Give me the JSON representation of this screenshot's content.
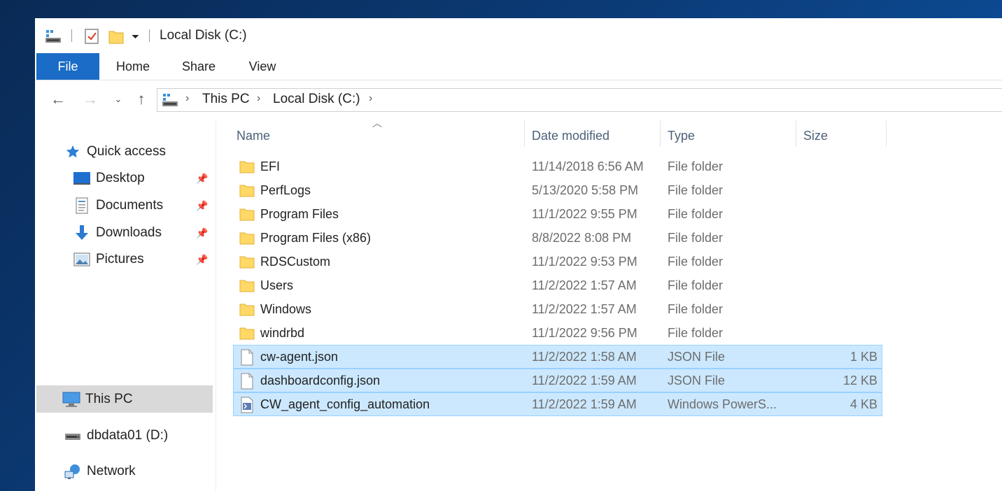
{
  "window": {
    "title": "Local Disk (C:)"
  },
  "ribbon": {
    "tabs": [
      "File",
      "Home",
      "Share",
      "View"
    ]
  },
  "address": {
    "crumbs": [
      "This PC",
      "Local Disk (C:)"
    ]
  },
  "nav": {
    "quick_access": "Quick access",
    "desktop": "Desktop",
    "documents": "Documents",
    "downloads": "Downloads",
    "pictures": "Pictures",
    "this_pc": "This PC",
    "dbdata": "dbdata01 (D:)",
    "network": "Network"
  },
  "columns": {
    "name": "Name",
    "date": "Date modified",
    "type": "Type",
    "size": "Size"
  },
  "files": [
    {
      "name": "EFI",
      "date": "11/14/2018 6:56 AM",
      "type": "File folder",
      "size": "",
      "icon": "folder-icon",
      "selected": false
    },
    {
      "name": "PerfLogs",
      "date": "5/13/2020 5:58 PM",
      "type": "File folder",
      "size": "",
      "icon": "folder-icon",
      "selected": false
    },
    {
      "name": "Program Files",
      "date": "11/1/2022 9:55 PM",
      "type": "File folder",
      "size": "",
      "icon": "folder-icon",
      "selected": false
    },
    {
      "name": "Program Files (x86)",
      "date": "8/8/2022 8:08 PM",
      "type": "File folder",
      "size": "",
      "icon": "folder-icon",
      "selected": false
    },
    {
      "name": "RDSCustom",
      "date": "11/1/2022 9:53 PM",
      "type": "File folder",
      "size": "",
      "icon": "folder-icon",
      "selected": false
    },
    {
      "name": "Users",
      "date": "11/2/2022 1:57 AM",
      "type": "File folder",
      "size": "",
      "icon": "folder-icon",
      "selected": false
    },
    {
      "name": "Windows",
      "date": "11/2/2022 1:57 AM",
      "type": "File folder",
      "size": "",
      "icon": "folder-icon",
      "selected": false
    },
    {
      "name": "windrbd",
      "date": "11/1/2022 9:56 PM",
      "type": "File folder",
      "size": "",
      "icon": "folder-icon",
      "selected": false
    },
    {
      "name": "cw-agent.json",
      "date": "11/2/2022 1:58 AM",
      "type": "JSON File",
      "size": "1 KB",
      "icon": "file-icon",
      "selected": true
    },
    {
      "name": "dashboardconfig.json",
      "date": "11/2/2022 1:59 AM",
      "type": "JSON File",
      "size": "12 KB",
      "icon": "file-icon",
      "selected": true
    },
    {
      "name": "CW_agent_config_automation",
      "date": "11/2/2022 1:59 AM",
      "type": "Windows PowerS...",
      "size": "4 KB",
      "icon": "powershell-script-icon",
      "selected": true
    }
  ],
  "colors": {
    "accent": "#1a6cc6",
    "selection": "#cce8ff",
    "selection_border": "#99d1ff",
    "folder": "#ffd866",
    "desktop_bg": "#0b3a75"
  }
}
